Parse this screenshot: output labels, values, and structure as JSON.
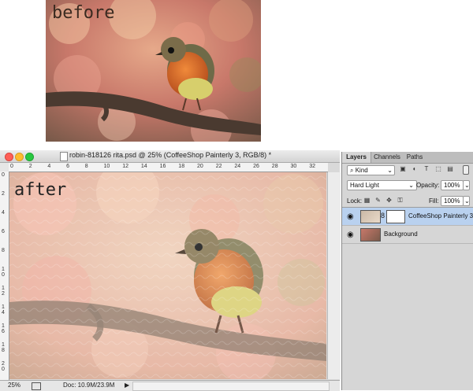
{
  "captions": {
    "before": "before",
    "after": "after"
  },
  "document": {
    "title": "robin-818126 rita.psd @ 25% (CoffeeShop Painterly 3, RGB/8) *",
    "ruler_top_labels": [
      "0",
      "2",
      "4",
      "6",
      "8",
      "10",
      "12",
      "14",
      "16",
      "18",
      "20",
      "22",
      "24",
      "26",
      "28",
      "30",
      "32"
    ],
    "ruler_left_labels": [
      "0",
      "2",
      "4",
      "6",
      "8",
      "1\n0",
      "1\n2",
      "1\n4",
      "1\n6",
      "1\n8",
      "2\n0"
    ],
    "zoom": "25%",
    "doc_size": "Doc: 10.9M/23.9M",
    "status_arrow": "▶"
  },
  "layers_panel": {
    "tabs": [
      "Layers",
      "Channels",
      "Paths"
    ],
    "active_tab": "Layers",
    "filter_kind": "Kind",
    "blend_mode": "Hard Light",
    "opacity_label": "Opacity:",
    "opacity_value": "100%",
    "lock_label": "Lock:",
    "fill_label": "Fill:",
    "fill_value": "100%",
    "layers": [
      {
        "name": "CoffeeShop Painterly 3",
        "selected": true,
        "visible": true,
        "has_mask": true
      },
      {
        "name": "Background",
        "selected": false,
        "visible": true,
        "has_mask": false
      }
    ]
  },
  "icons": {
    "eye": "eye-icon",
    "link": "chain-link-icon",
    "dropdown": "chevron-down-icon",
    "search": "search-icon"
  },
  "colors": {
    "selected_layer": "#b9d1ef",
    "close_button": "#ff5f57",
    "minimize_button": "#febc2e",
    "zoom_button": "#28c840"
  }
}
